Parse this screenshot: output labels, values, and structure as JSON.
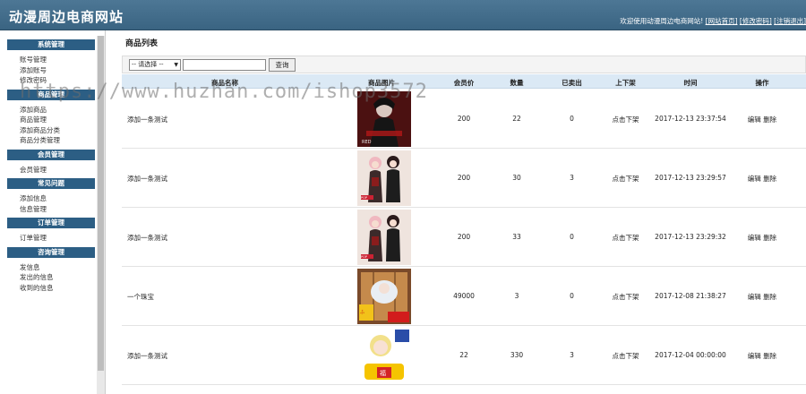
{
  "header": {
    "title": "动漫周边电商网站",
    "welcome": "欢迎使用动漫周边电商网站!",
    "links": [
      "[网站首页]",
      "[修改密码]",
      "[注销退出]"
    ]
  },
  "sidebar": {
    "groups": [
      {
        "title": "系统管理",
        "items": [
          "账号管理",
          "添加账号",
          "修改密码"
        ]
      },
      {
        "title": "商品管理",
        "items": [
          "添加商品",
          "商品管理",
          "添加商品分类",
          "商品分类管理"
        ]
      },
      {
        "title": "会员管理",
        "items": [
          "会员管理"
        ]
      },
      {
        "title": "常见问题",
        "items": [
          "添加信息",
          "信息管理"
        ]
      },
      {
        "title": "订单管理",
        "items": [
          "订单管理"
        ]
      },
      {
        "title": "咨询管理",
        "items": [
          "发信息",
          "发出的信息",
          "收到的信息"
        ]
      }
    ]
  },
  "main": {
    "heading": "商品列表",
    "select_value": "-- 请选择 --",
    "search_placeholder": "",
    "search_button": "查询",
    "columns": [
      "商品名称",
      "商品图片",
      "会员价",
      "数量",
      "已卖出",
      "上下架",
      "时间",
      "操作"
    ],
    "rows": [
      {
        "name": "添加一条测试",
        "price": "200",
        "qty": "22",
        "sold": "0",
        "shelf": "点击下架",
        "time": "2017-12-13 23:37:54",
        "edit": "编辑",
        "del": "删除",
        "image": "dark-figure"
      },
      {
        "name": "添加一条测试",
        "price": "200",
        "qty": "30",
        "sold": "3",
        "shelf": "点击下架",
        "time": "2017-12-13 23:29:57",
        "edit": "编辑",
        "del": "删除",
        "image": "two-characters"
      },
      {
        "name": "添加一条测试",
        "price": "200",
        "qty": "33",
        "sold": "0",
        "shelf": "点击下架",
        "time": "2017-12-13 23:29:32",
        "edit": "编辑",
        "del": "删除",
        "image": "two-characters"
      },
      {
        "name": "一个珠宝",
        "price": "49000",
        "qty": "3",
        "sold": "0",
        "shelf": "点击下架",
        "time": "2017-12-08 21:38:27",
        "edit": "编辑",
        "del": "删除",
        "image": "plush-figure"
      },
      {
        "name": "添加一条测试",
        "price": "22",
        "qty": "330",
        "sold": "3",
        "shelf": "点击下架",
        "time": "2017-12-04 00:00:00",
        "edit": "编辑",
        "del": "删除",
        "image": "chibi-figure"
      }
    ]
  },
  "watermark": "https://www.huzhan.com/ishop3572",
  "colors": {
    "header": "#3f6886",
    "sidebar_group": "#2c5e84",
    "table_head": "#dbe9f5"
  }
}
